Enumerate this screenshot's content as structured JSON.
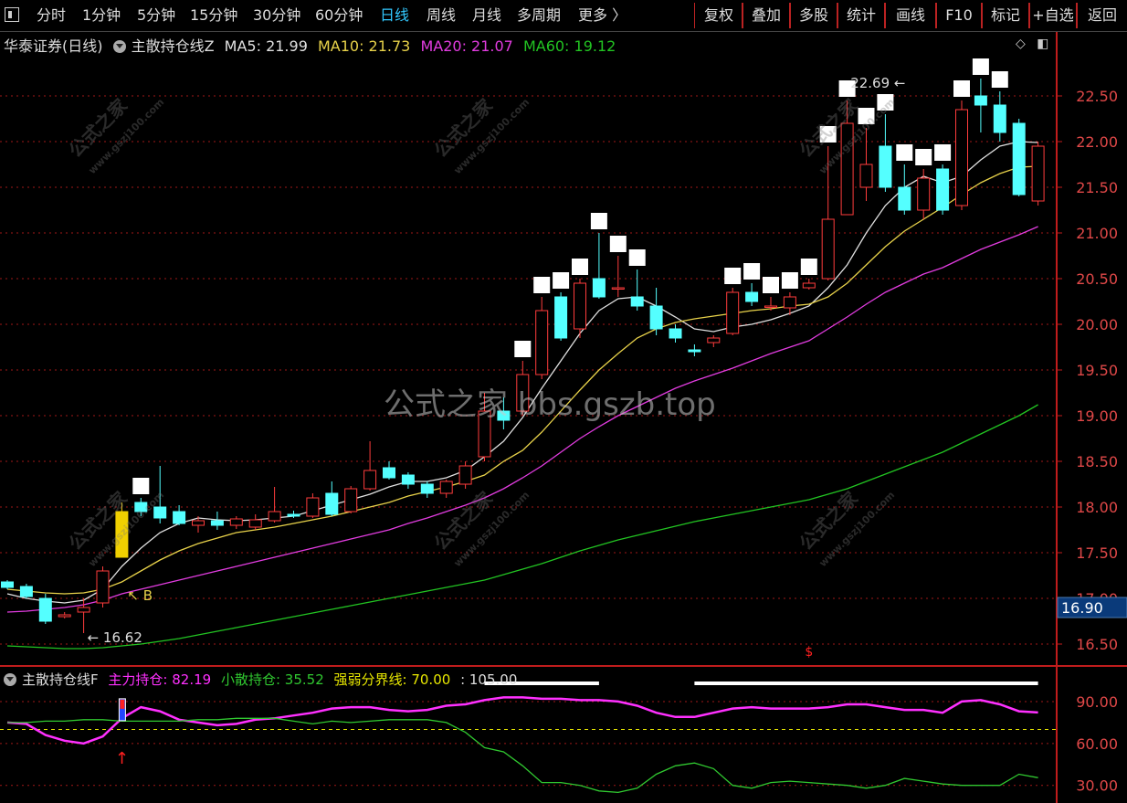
{
  "toolbar": {
    "periods": [
      "分时",
      "1分钟",
      "5分钟",
      "15分钟",
      "30分钟",
      "60分钟",
      "日线",
      "周线",
      "月线",
      "多周期",
      "更多 〉"
    ],
    "active_period": "日线",
    "right_buttons": [
      "复权",
      "叠加",
      "多股",
      "统计",
      "画线",
      "F10",
      "标记",
      "+自选",
      "返回"
    ]
  },
  "main_legend": {
    "stock": "华泰证券(日线)",
    "indicator": "主散持仓线Z",
    "ma5": "MA5: 21.99",
    "ma10": "MA10: 21.73",
    "ma20": "MA20: 21.07",
    "ma60": "MA60: 19.12"
  },
  "sub_legend": {
    "indicator": "主散持仓线F",
    "main": "主力持仓: 82.19",
    "retail": "小散持仓: 35.52",
    "threshold": "强弱分界线: 70.00",
    "extra": ": 105.00"
  },
  "watermark": "公式之家 bbs.gszb.top",
  "watermark_small": [
    "公式之家",
    "www.gszj100.com"
  ],
  "colors": {
    "up": "#ff3c3c",
    "down": "#54ffff",
    "ma5": "#e0e0e0",
    "ma10": "#e8d24a",
    "ma20": "#e23ce0",
    "ma60": "#22c422",
    "grid": "#a01818",
    "axis": "#c01c1c",
    "main_line": "#ff30ff",
    "retail_line": "#30c830",
    "threshold": "#e8e800"
  },
  "chart_data": [
    {
      "type": "candlestick",
      "title": "华泰证券(日线)",
      "ylim": [
        16.3,
        22.95
      ],
      "y_ticks": [
        16.5,
        17.0,
        17.5,
        18.0,
        18.5,
        19.0,
        19.5,
        20.0,
        20.5,
        21.0,
        21.5,
        22.0,
        22.5
      ],
      "y_tick_labels": [
        "16.50",
        "17.00",
        "17.50",
        "18.00",
        "18.50",
        "19.00",
        "19.50",
        "20.00",
        "20.50",
        "21.00",
        "21.50",
        "22.00",
        "22.50"
      ],
      "current_price_label": "16.90",
      "current_price": 16.9,
      "annotations": [
        {
          "text": "22.69",
          "value": 22.69,
          "index": 48
        },
        {
          "text": "16.62",
          "value": 16.62,
          "index": 4
        },
        {
          "text": "B",
          "value": 17.08,
          "index": 6
        },
        {
          "text": "$",
          "value": 16.45,
          "index": 42
        }
      ],
      "highlight_index": 6,
      "candles": [
        [
          17.18,
          17.12,
          17.2,
          17.1
        ],
        [
          17.13,
          17.02,
          17.16,
          17.0
        ],
        [
          17.0,
          16.75,
          17.05,
          16.72
        ],
        [
          16.8,
          16.82,
          16.85,
          16.78
        ],
        [
          16.85,
          16.9,
          17.0,
          16.62
        ],
        [
          16.95,
          17.3,
          17.35,
          16.9
        ],
        [
          17.45,
          17.95,
          18.05,
          17.45
        ],
        [
          18.05,
          17.95,
          18.1,
          17.9
        ],
        [
          18.0,
          17.88,
          18.45,
          17.82
        ],
        [
          17.95,
          17.82,
          18.02,
          17.8
        ],
        [
          17.8,
          17.85,
          17.9,
          17.72
        ],
        [
          17.85,
          17.8,
          17.95,
          17.75
        ],
        [
          17.8,
          17.87,
          17.9,
          17.76
        ],
        [
          17.78,
          17.86,
          17.92,
          17.75
        ],
        [
          17.85,
          17.95,
          18.22,
          17.83
        ],
        [
          17.92,
          17.9,
          17.96,
          17.88
        ],
        [
          17.9,
          18.1,
          18.15,
          17.88
        ],
        [
          18.15,
          17.92,
          18.28,
          17.9
        ],
        [
          17.95,
          18.2,
          18.23,
          17.93
        ],
        [
          18.2,
          18.4,
          18.72,
          18.18
        ],
        [
          18.43,
          18.32,
          18.5,
          18.3
        ],
        [
          18.35,
          18.25,
          18.38,
          18.2
        ],
        [
          18.25,
          18.15,
          18.28,
          18.1
        ],
        [
          18.15,
          18.28,
          18.3,
          18.1
        ],
        [
          18.25,
          18.45,
          18.5,
          18.2
        ],
        [
          18.55,
          19.05,
          19.25,
          18.5
        ],
        [
          19.05,
          18.95,
          19.2,
          18.85
        ],
        [
          19.05,
          19.45,
          19.6,
          19.0
        ],
        [
          19.45,
          20.15,
          20.3,
          19.4
        ],
        [
          20.3,
          19.85,
          20.35,
          19.82
        ],
        [
          19.95,
          20.45,
          20.5,
          19.85
        ],
        [
          20.5,
          20.3,
          21.0,
          20.28
        ],
        [
          20.4,
          20.4,
          20.75,
          20.3
        ],
        [
          20.3,
          20.2,
          20.6,
          20.15
        ],
        [
          20.2,
          19.95,
          20.4,
          19.88
        ],
        [
          19.95,
          19.85,
          20.0,
          19.8
        ],
        [
          19.72,
          19.7,
          19.78,
          19.65
        ],
        [
          19.8,
          19.85,
          19.88,
          19.75
        ],
        [
          19.9,
          20.35,
          20.4,
          19.88
        ],
        [
          20.35,
          20.25,
          20.45,
          20.2
        ],
        [
          20.2,
          20.2,
          20.3,
          20.15
        ],
        [
          20.18,
          20.3,
          20.35,
          20.1
        ],
        [
          20.4,
          20.45,
          20.5,
          20.38
        ],
        [
          20.5,
          21.15,
          21.95,
          20.48
        ],
        [
          21.2,
          22.2,
          22.45,
          21.2
        ],
        [
          21.5,
          21.75,
          22.15,
          21.35
        ],
        [
          21.95,
          21.5,
          22.3,
          21.45
        ],
        [
          21.5,
          21.25,
          21.75,
          21.2
        ],
        [
          21.25,
          21.6,
          21.7,
          21.15
        ],
        [
          21.7,
          21.25,
          21.75,
          21.2
        ],
        [
          21.3,
          22.35,
          22.45,
          21.25
        ],
        [
          22.5,
          22.4,
          22.69,
          22.1
        ],
        [
          22.4,
          22.1,
          22.55,
          22.0
        ],
        [
          22.2,
          21.42,
          22.25,
          21.4
        ],
        [
          21.35,
          21.95,
          22.0,
          21.3
        ]
      ],
      "series": [
        {
          "name": "MA5",
          "color": "#e0e0e0",
          "values": [
            17.05,
            17.0,
            16.97,
            16.95,
            16.98,
            17.1,
            17.35,
            17.55,
            17.72,
            17.82,
            17.88,
            17.86,
            17.85,
            17.86,
            17.88,
            17.9,
            17.96,
            18.02,
            18.08,
            18.14,
            18.22,
            18.28,
            18.28,
            18.32,
            18.4,
            18.55,
            18.72,
            18.98,
            19.3,
            19.6,
            19.9,
            20.15,
            20.28,
            20.3,
            20.2,
            20.08,
            19.95,
            19.92,
            19.97,
            20.0,
            20.05,
            20.12,
            20.2,
            20.4,
            20.65,
            21.0,
            21.3,
            21.5,
            21.62,
            21.55,
            21.62,
            21.8,
            21.95,
            22.0,
            21.99
          ]
        },
        {
          "name": "MA10",
          "color": "#e8d24a",
          "values": [
            17.1,
            17.08,
            17.06,
            17.05,
            17.06,
            17.1,
            17.18,
            17.3,
            17.42,
            17.52,
            17.6,
            17.66,
            17.72,
            17.75,
            17.78,
            17.82,
            17.86,
            17.9,
            17.95,
            18.0,
            18.05,
            18.12,
            18.17,
            18.22,
            18.28,
            18.35,
            18.5,
            18.62,
            18.82,
            19.05,
            19.28,
            19.5,
            19.68,
            19.85,
            19.95,
            20.02,
            20.06,
            20.09,
            20.12,
            20.15,
            20.17,
            20.2,
            20.22,
            20.3,
            20.45,
            20.65,
            20.85,
            21.02,
            21.15,
            21.28,
            21.42,
            21.55,
            21.65,
            21.72,
            21.73
          ]
        },
        {
          "name": "MA20",
          "color": "#e23ce0",
          "values": [
            16.85,
            16.86,
            16.88,
            16.9,
            16.93,
            16.98,
            17.05,
            17.1,
            17.15,
            17.2,
            17.25,
            17.3,
            17.35,
            17.4,
            17.45,
            17.5,
            17.55,
            17.6,
            17.65,
            17.7,
            17.75,
            17.82,
            17.88,
            17.95,
            18.02,
            18.1,
            18.2,
            18.32,
            18.45,
            18.6,
            18.75,
            18.88,
            19.0,
            19.1,
            19.2,
            19.3,
            19.38,
            19.45,
            19.52,
            19.6,
            19.68,
            19.75,
            19.82,
            19.95,
            20.08,
            20.22,
            20.35,
            20.45,
            20.55,
            20.62,
            20.72,
            20.82,
            20.9,
            20.98,
            21.07
          ]
        },
        {
          "name": "MA60",
          "color": "#22c422",
          "values": [
            16.48,
            16.47,
            16.46,
            16.45,
            16.45,
            16.46,
            16.48,
            16.5,
            16.53,
            16.56,
            16.6,
            16.64,
            16.68,
            16.72,
            16.76,
            16.8,
            16.84,
            16.88,
            16.92,
            16.96,
            17.0,
            17.04,
            17.08,
            17.12,
            17.16,
            17.2,
            17.26,
            17.32,
            17.38,
            17.45,
            17.52,
            17.58,
            17.64,
            17.69,
            17.74,
            17.79,
            17.84,
            17.88,
            17.92,
            17.96,
            18.0,
            18.04,
            18.08,
            18.14,
            18.2,
            18.28,
            18.36,
            18.44,
            18.52,
            18.6,
            18.7,
            18.8,
            18.9,
            19.0,
            19.12
          ]
        }
      ]
    },
    {
      "type": "line",
      "title": "主散持仓线F",
      "ylim": [
        20,
        105
      ],
      "y_ticks": [
        30,
        60,
        90
      ],
      "y_tick_labels": [
        "30.00",
        "60.00",
        "90.00"
      ],
      "threshold": 70,
      "bars": [
        {
          "from_index": 25,
          "to_index": 31,
          "value": 103
        },
        {
          "from_index": 36,
          "to_index": 54,
          "value": 103
        }
      ],
      "signal_index": 6,
      "series": [
        {
          "name": "主力持仓",
          "color": "#ff30ff",
          "values": [
            75,
            74,
            66,
            62,
            60,
            65,
            78,
            86,
            83,
            77,
            75,
            73,
            74,
            77,
            78,
            80,
            82,
            85,
            86,
            86,
            84,
            83,
            84,
            87,
            88,
            91,
            93,
            93,
            92,
            92,
            91,
            91,
            90,
            87,
            82,
            79,
            79,
            82,
            85,
            86,
            85,
            85,
            85,
            86,
            88,
            88,
            86,
            84,
            84,
            82,
            90,
            91,
            88,
            83,
            82.19
          ]
        },
        {
          "name": "小散持仓",
          "color": "#30c830",
          "values": [
            75,
            75,
            76,
            76,
            77,
            77,
            76,
            76,
            76,
            76,
            77,
            77,
            78,
            78,
            78,
            76,
            74,
            76,
            75,
            76,
            77,
            77,
            77,
            75,
            68,
            57,
            54,
            44,
            32,
            32,
            30,
            26,
            25,
            28,
            38,
            44,
            46,
            42,
            30,
            28,
            32,
            33,
            32,
            31,
            30,
            28,
            30,
            35,
            33,
            31,
            30,
            30,
            30,
            38,
            35.52
          ]
        }
      ]
    }
  ]
}
